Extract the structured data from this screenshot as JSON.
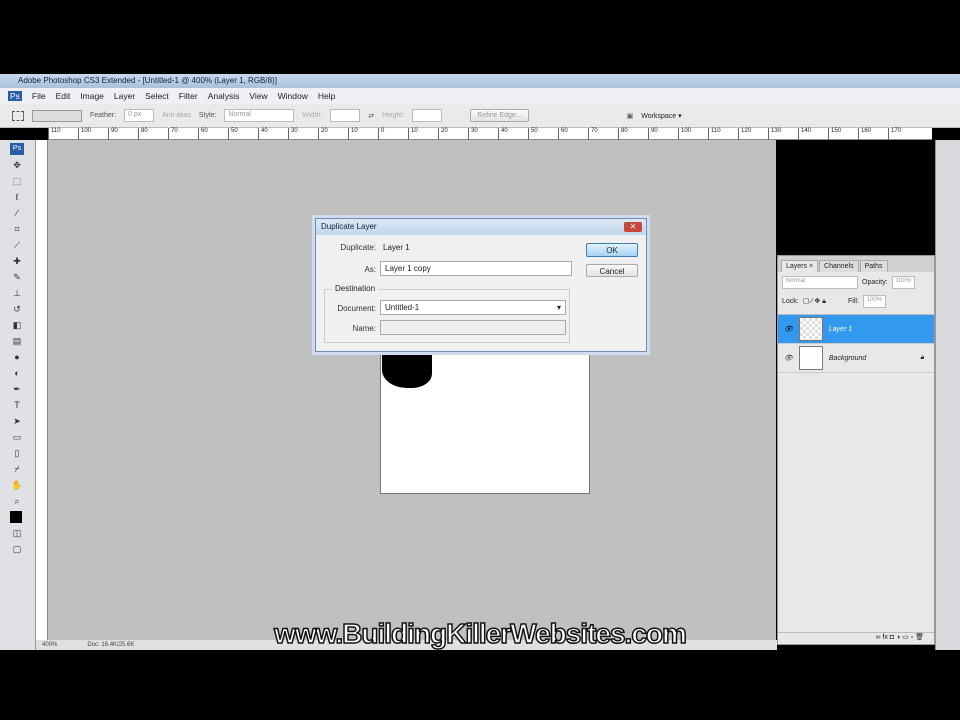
{
  "window": {
    "title": "Adobe Photoshop CS3 Extended - [Untitled-1 @ 400% (Layer 1, RGB/8)]"
  },
  "menu": [
    "File",
    "Edit",
    "Image",
    "Layer",
    "Select",
    "Filter",
    "Analysis",
    "View",
    "Window",
    "Help"
  ],
  "options": {
    "feather_label": "Feather:",
    "feather_value": "0 px",
    "antialias": "Anti-alias",
    "style_label": "Style:",
    "style_value": "Normal",
    "width_label": "Width:",
    "height_label": "Height:",
    "refine_edge": "Refine Edge...",
    "workspace": "Workspace ▾"
  },
  "ruler": [
    "110",
    "100",
    "90",
    "80",
    "70",
    "60",
    "50",
    "40",
    "30",
    "20",
    "10",
    "0",
    "10",
    "20",
    "30",
    "40",
    "50",
    "60",
    "70",
    "80",
    "90",
    "100",
    "110",
    "120",
    "130",
    "140",
    "150",
    "160",
    "170"
  ],
  "dialog": {
    "title": "Duplicate Layer",
    "duplicate_label": "Duplicate:",
    "duplicate_value": "Layer 1",
    "as_label": "As:",
    "as_value": "Layer 1 copy",
    "destination": "Destination",
    "document_label": "Document:",
    "document_value": "Untitled-1",
    "name_label": "Name:",
    "ok": "OK",
    "cancel": "Cancel"
  },
  "layers_panel": {
    "tabs": [
      "Layers ×",
      "Channels",
      "Paths"
    ],
    "blend": "Normal",
    "opacity_label": "Opacity:",
    "opacity": "100%",
    "lock_label": "Lock:",
    "fill_label": "Fill:",
    "fill": "100%",
    "layers": [
      {
        "name": "Layer 1",
        "selected": true
      },
      {
        "name": "Background",
        "selected": false
      }
    ]
  },
  "status": {
    "zoom": "400%",
    "doc": "Doc: 16.4K/25.6K"
  },
  "watermark": "www.BuildingKillerWebsites.com"
}
